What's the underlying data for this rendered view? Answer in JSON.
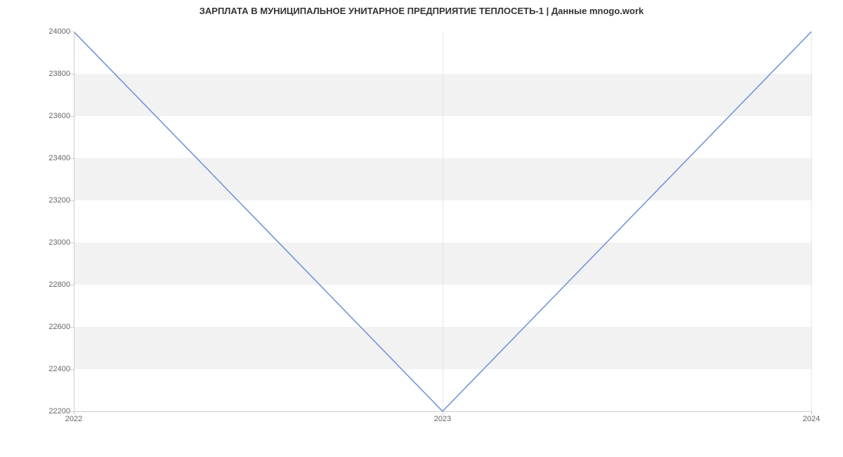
{
  "chart_data": {
    "type": "line",
    "title": "ЗАРПЛАТА В МУНИЦИПАЛЬНОЕ УНИТАРНОЕ ПРЕДПРИЯТИЕ ТЕПЛОСЕТЬ-1 | Данные mnogo.work",
    "x": [
      2022,
      2023,
      2024
    ],
    "values": [
      24000,
      22200,
      24000
    ],
    "xlabel": "",
    "ylabel": "",
    "xlim": [
      2022,
      2024
    ],
    "ylim": [
      22200,
      24000
    ],
    "y_ticks": [
      22200,
      22400,
      22600,
      22800,
      23000,
      23200,
      23400,
      23600,
      23800,
      24000
    ],
    "x_ticks": [
      2022,
      2023,
      2024
    ],
    "line_color": "#6a8fd8"
  }
}
